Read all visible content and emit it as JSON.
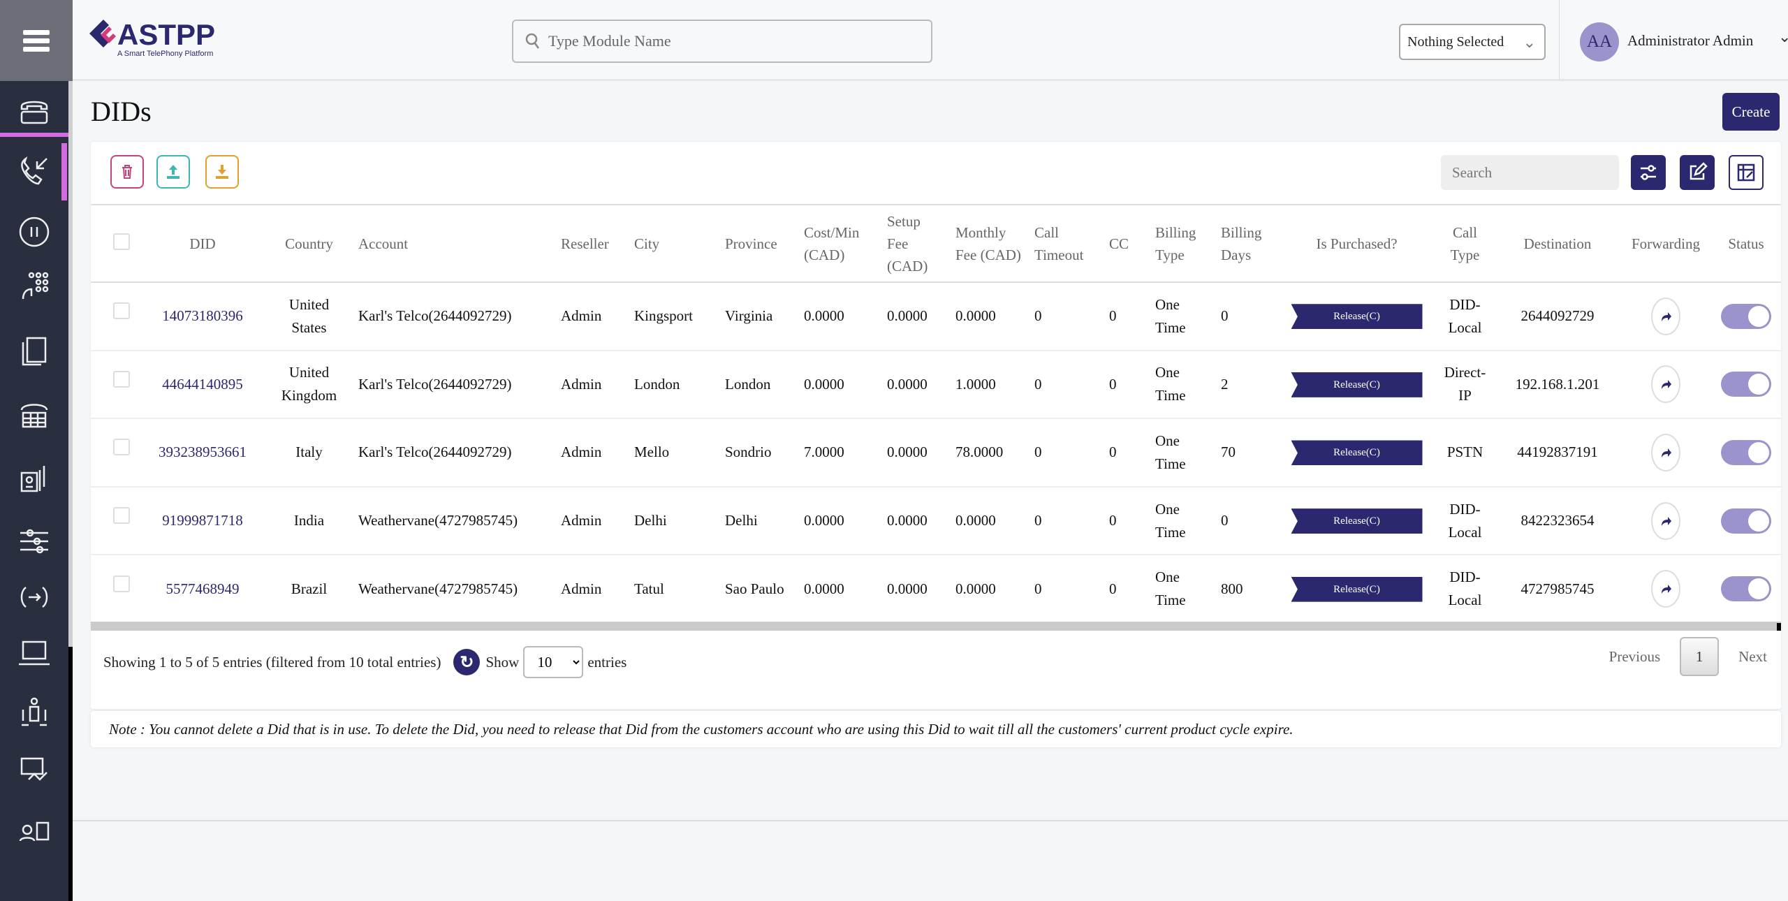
{
  "app": {
    "logo_text": "ASTPP",
    "logo_tagline": "A Smart TelePhony Platform"
  },
  "header": {
    "search_placeholder": "Type Module Name",
    "select_value": "Nothing Selected",
    "avatar_initials": "AA",
    "user_name": "Administrator Admin"
  },
  "page": {
    "title": "DIDs",
    "create_label": "Create"
  },
  "toolbar": {
    "search_placeholder": "Search",
    "delete_icon": "trash-icon",
    "import_icon": "upload-icon",
    "export_icon": "download-icon"
  },
  "colors": {
    "primary": "#2b2870",
    "toggle": "#9a93cc",
    "accent": "#d56be0",
    "delete": "#c0457a",
    "import": "#3fb6b0",
    "export": "#e0a030"
  },
  "table": {
    "headers": {
      "did": "DID",
      "country": "Country",
      "account": "Account",
      "reseller": "Reseller",
      "city": "City",
      "province": "Province",
      "cost": "Cost/Min (CAD)",
      "setup": "Setup Fee (CAD)",
      "monthly": "Monthly Fee (CAD)",
      "timeout": "Call Timeout",
      "cc": "CC",
      "btype": "Billing Type",
      "bdays": "Billing Days",
      "purchased": "Is Purchased?",
      "calltype": "Call Type",
      "destination": "Destination",
      "forwarding": "Forwarding",
      "status": "Status"
    },
    "rows": [
      {
        "did": "14073180396",
        "country": "United States",
        "account": "Karl's Telco(2644092729)",
        "reseller": "Admin",
        "city": "Kingsport",
        "province": "Virginia",
        "cost": "0.0000",
        "setup": "0.0000",
        "monthly": "0.0000",
        "timeout": "0",
        "cc": "0",
        "btype": "One Time",
        "bdays": "0",
        "purchased": "Release(C)",
        "calltype": "DID-Local",
        "destination": "2644092729",
        "status": true
      },
      {
        "did": "44644140895",
        "country": "United Kingdom",
        "account": "Karl's Telco(2644092729)",
        "reseller": "Admin",
        "city": "London",
        "province": "London",
        "cost": "0.0000",
        "setup": "0.0000",
        "monthly": "1.0000",
        "timeout": "0",
        "cc": "0",
        "btype": "One Time",
        "bdays": "2",
        "purchased": "Release(C)",
        "calltype": "Direct-IP",
        "destination": "192.168.1.201",
        "status": true
      },
      {
        "did": "393238953661",
        "country": "Italy",
        "account": "Karl's Telco(2644092729)",
        "reseller": "Admin",
        "city": "Mello",
        "province": "Sondrio",
        "cost": "7.0000",
        "setup": "0.0000",
        "monthly": "78.0000",
        "timeout": "0",
        "cc": "0",
        "btype": "One Time",
        "bdays": "70",
        "purchased": "Release(C)",
        "calltype": "PSTN",
        "destination": "44192837191",
        "status": true
      },
      {
        "did": "91999871718",
        "country": "India",
        "account": "Weathervane(4727985745)",
        "reseller": "Admin",
        "city": "Delhi",
        "province": "Delhi",
        "cost": "0.0000",
        "setup": "0.0000",
        "monthly": "0.0000",
        "timeout": "0",
        "cc": "0",
        "btype": "One Time",
        "bdays": "0",
        "purchased": "Release(C)",
        "calltype": "DID-Local",
        "destination": "8422323654",
        "status": true
      },
      {
        "did": "5577468949",
        "country": "Brazil",
        "account": "Weathervane(4727985745)",
        "reseller": "Admin",
        "city": "Tatul",
        "province": "Sao Paulo",
        "cost": "0.0000",
        "setup": "0.0000",
        "monthly": "0.0000",
        "timeout": "0",
        "cc": "0",
        "btype": "One Time",
        "bdays": "800",
        "purchased": "Release(C)",
        "calltype": "DID-Local",
        "destination": "4727985745",
        "status": true
      }
    ]
  },
  "footer": {
    "info": "Showing 1 to 5 of 5 entries (filtered from 10 total entries)",
    "show": "Show",
    "page_size": "10",
    "entries": "entries",
    "previous": "Previous",
    "current_page": "1",
    "next": "Next"
  },
  "note": "Note : You cannot delete a Did that is in use. To delete the Did, you need to release that Did from the customers account who are using this Did to wait till all the customers' current product cycle expire."
}
